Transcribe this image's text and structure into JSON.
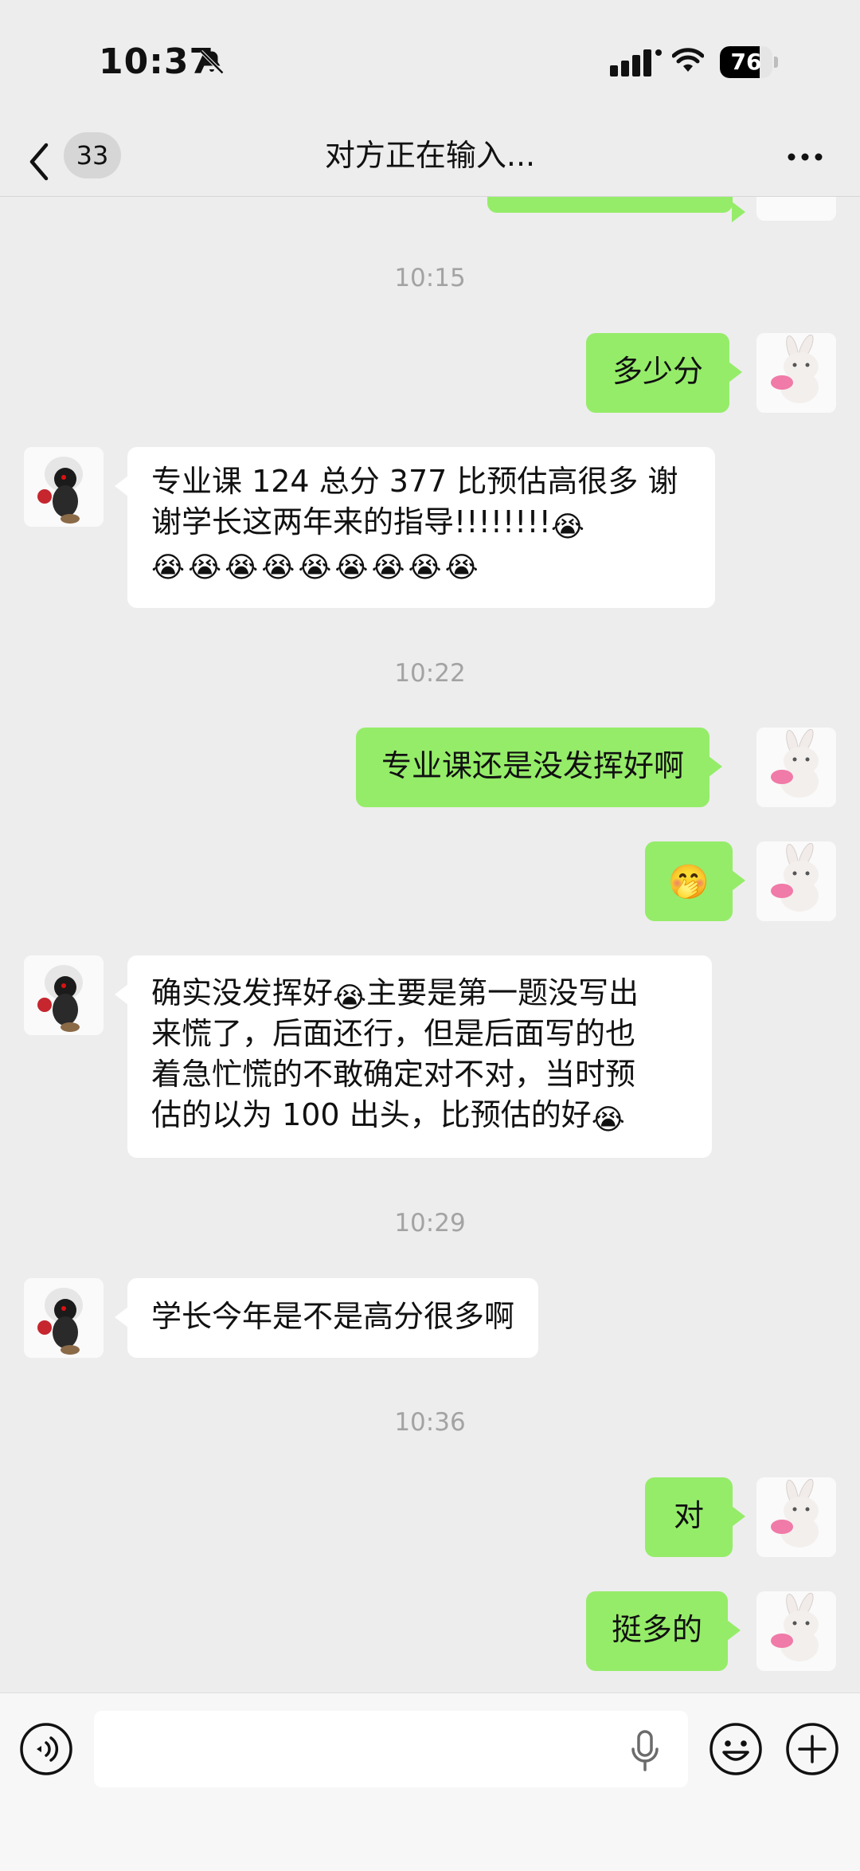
{
  "status_bar": {
    "time": "10:37",
    "battery": "76",
    "battery_level": 0.76
  },
  "nav": {
    "back_count": "33",
    "title": "对方正在输入..."
  },
  "messages": [
    {
      "type": "timestamp",
      "text": "10:15"
    },
    {
      "type": "out",
      "text": "多少分"
    },
    {
      "type": "in",
      "text_line1": "专业课 124 总分 377 比预估高很多 谢",
      "text_line2": "谢学长这两年来的指导!!!!!!!!",
      "emoji": "loudly-crying-face",
      "emoji_glyph": "😭",
      "emoji_count": 9
    },
    {
      "type": "timestamp",
      "text": "10:22"
    },
    {
      "type": "out",
      "text": "专业课还是没发挥好啊"
    },
    {
      "type": "out",
      "emoji": "face-with-hand-over-mouth-laughing",
      "emoji_glyph": "🤭"
    },
    {
      "type": "in",
      "text_line1a": "确实没发挥好",
      "text_line1b": "主要是第一题没写出",
      "text_line2": "来慌了，后面还行，但是后面写的也",
      "text_line3": "着急忙慌的不敢确定对不对，当时预",
      "text_line4": "估的以为 100 出头，比预估的好"
    },
    {
      "type": "timestamp",
      "text": "10:29"
    },
    {
      "type": "in",
      "text": "学长今年是不是高分很多啊"
    },
    {
      "type": "timestamp",
      "text": "10:36"
    },
    {
      "type": "out",
      "text": "对"
    },
    {
      "type": "out",
      "text": "挺多的"
    }
  ],
  "icons": {
    "voice": "voice-mode-icon",
    "mic": "microphone-icon",
    "emoji": "emoji-icon",
    "plus": "plus-icon",
    "more": "more-dots-icon",
    "back": "chevron-left-icon"
  },
  "colors": {
    "out_bubble": "#95ec69",
    "in_bubble": "#ffffff",
    "background": "#ededed"
  }
}
